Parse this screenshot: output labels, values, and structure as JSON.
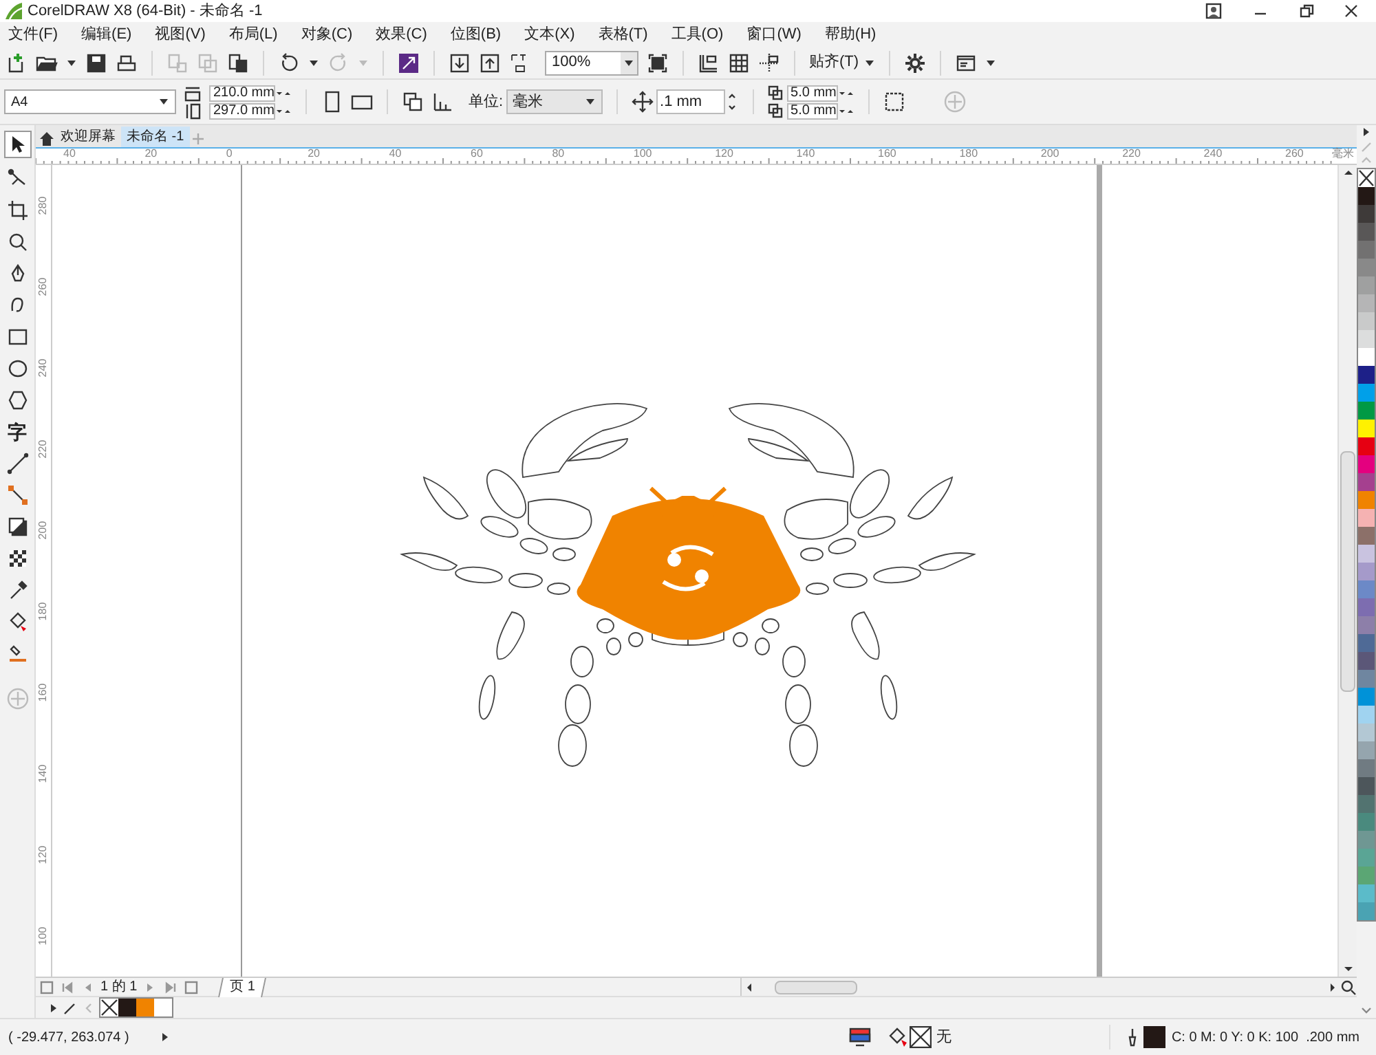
{
  "window": {
    "title": "CorelDRAW X8 (64-Bit) - 未命名 -1"
  },
  "menu": [
    "文件(F)",
    "编辑(E)",
    "视图(V)",
    "布局(L)",
    "对象(C)",
    "效果(C)",
    "位图(B)",
    "文本(X)",
    "表格(T)",
    "工具(O)",
    "窗口(W)",
    "帮助(H)"
  ],
  "standard_toolbar": {
    "zoom": "100%",
    "snap": "贴齐(T)"
  },
  "property_bar": {
    "page_size": "A4",
    "width": "210.0 mm",
    "height": "297.0 mm",
    "unit_label": "单位:",
    "unit": "毫米",
    "nudge": ".1 mm",
    "duplicate_x": "5.0 mm",
    "duplicate_y": "5.0 mm"
  },
  "toolbox": {
    "text_tool": "字"
  },
  "document_tabs": [
    {
      "label": "欢迎屏幕",
      "selected": false
    },
    {
      "label": "未命名 -1",
      "selected": true
    }
  ],
  "horizontal_ruler": {
    "labels": [
      "40",
      "20",
      "0",
      "20",
      "40",
      "60",
      "80",
      "100",
      "120",
      "140",
      "160",
      "180",
      "200",
      "220",
      "240",
      "260"
    ],
    "unit": "毫米"
  },
  "vertical_ruler": {
    "labels": [
      "280",
      "260",
      "240",
      "220",
      "200",
      "180",
      "160",
      "140",
      "120",
      "100"
    ]
  },
  "page_navigator": {
    "position": "1 的 1",
    "page_tab": "页 1"
  },
  "document_palette": [
    {
      "kind": "none"
    },
    {
      "kind": "color",
      "color": "#231815"
    },
    {
      "kind": "color",
      "color": "#f08300"
    },
    {
      "kind": "color",
      "color": "#ffffff"
    }
  ],
  "color_palette": [
    {
      "kind": "none"
    },
    {
      "kind": "color",
      "color": "#231815"
    },
    {
      "kind": "color",
      "color": "#3e3a39"
    },
    {
      "kind": "color",
      "color": "#595757"
    },
    {
      "kind": "color",
      "color": "#727171"
    },
    {
      "kind": "color",
      "color": "#898989"
    },
    {
      "kind": "color",
      "color": "#9fa0a0"
    },
    {
      "kind": "color",
      "color": "#b5b5b6"
    },
    {
      "kind": "color",
      "color": "#c9caca"
    },
    {
      "kind": "color",
      "color": "#dcdddd"
    },
    {
      "kind": "color",
      "color": "#ffffff"
    },
    {
      "kind": "color",
      "color": "#1d2088"
    },
    {
      "kind": "color",
      "color": "#00a0e9"
    },
    {
      "kind": "color",
      "color": "#009944"
    },
    {
      "kind": "color",
      "color": "#fff100"
    },
    {
      "kind": "color",
      "color": "#e60012"
    },
    {
      "kind": "color",
      "color": "#e4007f"
    },
    {
      "kind": "color",
      "color": "#a5408f"
    },
    {
      "kind": "color",
      "color": "#f08300"
    },
    {
      "kind": "color",
      "color": "#f5b2b2"
    },
    {
      "kind": "color",
      "color": "#8c7069"
    },
    {
      "kind": "color",
      "color": "#c9c3e0"
    },
    {
      "kind": "color",
      "color": "#a59aca"
    },
    {
      "kind": "color",
      "color": "#6c89c7"
    },
    {
      "kind": "color",
      "color": "#7d6db0"
    },
    {
      "kind": "color",
      "color": "#8d7fa9"
    },
    {
      "kind": "color",
      "color": "#4f6a96"
    },
    {
      "kind": "color",
      "color": "#5b5778"
    },
    {
      "kind": "color",
      "color": "#6f86a0"
    },
    {
      "kind": "color",
      "color": "#0092d8"
    },
    {
      "kind": "color",
      "color": "#a0d3f0"
    },
    {
      "kind": "color",
      "color": "#b3c8d4"
    },
    {
      "kind": "color",
      "color": "#95a5ae"
    },
    {
      "kind": "color",
      "color": "#707b82"
    },
    {
      "kind": "color",
      "color": "#4d565b"
    },
    {
      "kind": "color",
      "color": "#527370"
    },
    {
      "kind": "color",
      "color": "#4a8a7e"
    },
    {
      "kind": "color",
      "color": "#6f9793"
    },
    {
      "kind": "color",
      "color": "#5aa595"
    },
    {
      "kind": "color",
      "color": "#5ba674"
    },
    {
      "kind": "color",
      "color": "#5bbbc9"
    },
    {
      "kind": "color",
      "color": "#4aa3b3"
    }
  ],
  "status_bar": {
    "coordinates": "( -29.477, 263.074 )",
    "fill_label": "无",
    "outline": "C: 0 M: 0 Y: 0 K: 100  .200 mm"
  }
}
